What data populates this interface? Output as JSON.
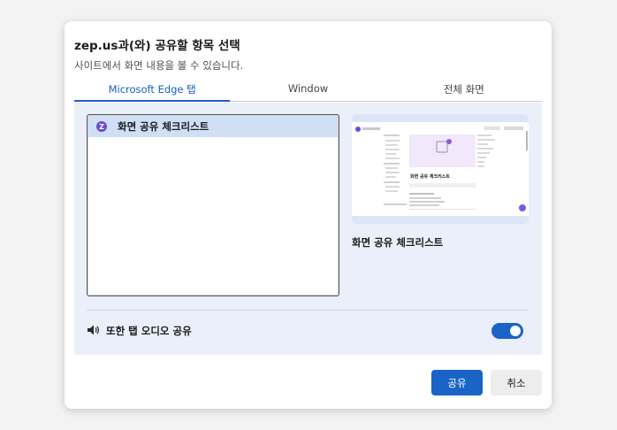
{
  "dialog": {
    "title": "zep.us과(와) 공유할 항목 선택",
    "subtitle": "사이트에서 화면 내용을 볼 수 있습니다."
  },
  "tabs": [
    {
      "label": "Microsoft Edge 탭",
      "active": true
    },
    {
      "label": "Window",
      "active": false
    },
    {
      "label": "전체 화면",
      "active": false
    }
  ],
  "tab_list": {
    "items": [
      {
        "label": "화면 공유 체크리스트",
        "favicon": "zep-favicon",
        "selected": true
      }
    ]
  },
  "preview": {
    "caption": "화면 공유 체크리스트",
    "thumb_heading": "화면 공유 체크리스트"
  },
  "audio": {
    "label": "또한 탭 오디오 공유",
    "enabled": true
  },
  "buttons": {
    "share": "공유",
    "cancel": "취소"
  },
  "colors": {
    "accent": "#1a64c8",
    "panel_bg": "#eaeff9",
    "selected_row": "#cfdff5"
  }
}
